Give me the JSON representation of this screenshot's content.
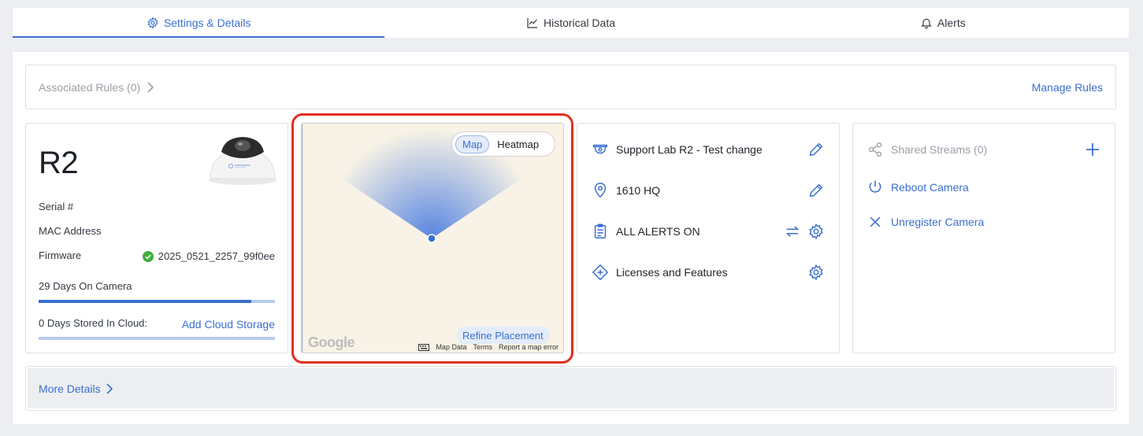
{
  "tabs": [
    {
      "label": "Settings & Details",
      "icon": "gear-icon",
      "active": true
    },
    {
      "label": "Historical Data",
      "icon": "line-chart-icon",
      "active": false
    },
    {
      "label": "Alerts",
      "icon": "bell-icon",
      "active": false
    }
  ],
  "rules": {
    "label": "Associated Rules (0)",
    "manage": "Manage Rules"
  },
  "camera": {
    "name": "R2",
    "serial_label": "Serial #",
    "mac_label": "MAC Address",
    "firmware_label": "Firmware",
    "firmware_value": "2025_0521_2257_99f0ee",
    "days_on_camera": "29 Days On Camera",
    "days_on_camera_fraction": 0.9,
    "days_cloud": "0 Days Stored In Cloud:",
    "add_storage": "Add Cloud Storage",
    "cloud_fraction": 0.0
  },
  "map": {
    "toggle_map": "Map",
    "toggle_heatmap": "Heatmap",
    "refine": "Refine Placement",
    "google": "Google",
    "map_data": "Map Data",
    "terms": "Terms",
    "report": "Report a map error"
  },
  "info": {
    "camera_label": "Support Lab R2 - Test change",
    "location": "1610 HQ",
    "alerts": "ALL ALERTS ON",
    "licenses": "Licenses and Features"
  },
  "actions": {
    "shared_streams": "Shared Streams (0)",
    "reboot": "Reboot Camera",
    "unregister": "Unregister Camera"
  },
  "more": {
    "label": "More Details"
  },
  "colors": {
    "accent": "#3a6fd0",
    "highlight": "#e0301e",
    "ok": "#3fae3a"
  }
}
